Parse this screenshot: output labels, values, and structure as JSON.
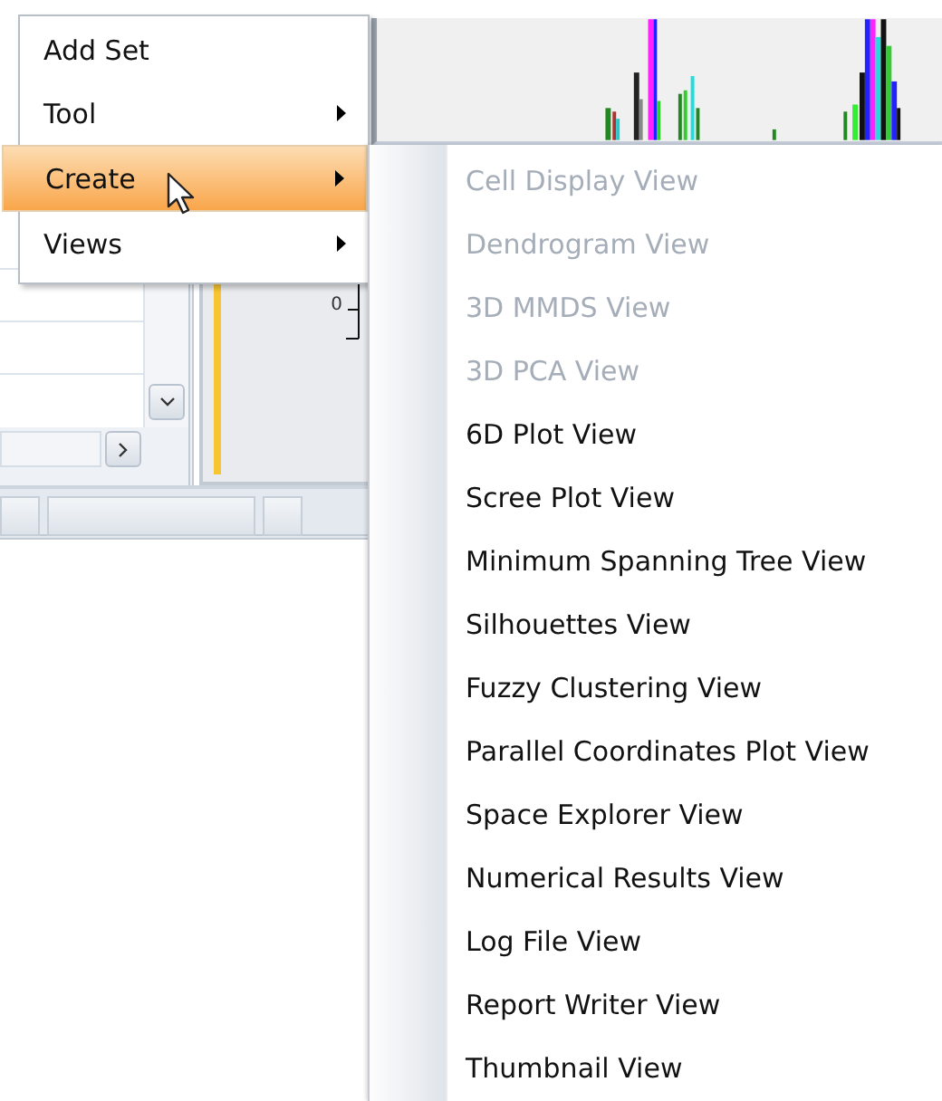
{
  "menu": {
    "items": [
      {
        "label": "Add Set",
        "has_submenu": false,
        "selected": false
      },
      {
        "label": "Tool",
        "has_submenu": true,
        "selected": false
      },
      {
        "label": "Create",
        "has_submenu": true,
        "selected": true
      },
      {
        "label": "Views",
        "has_submenu": true,
        "selected": false
      }
    ]
  },
  "submenu": {
    "items": [
      {
        "label": "Cell Display View",
        "disabled": true
      },
      {
        "label": "Dendrogram View",
        "disabled": true
      },
      {
        "label": "3D MMDS View",
        "disabled": true
      },
      {
        "label": "3D PCA View",
        "disabled": true
      },
      {
        "label": "6D Plot View",
        "disabled": false
      },
      {
        "label": "Scree Plot View",
        "disabled": false
      },
      {
        "label": "Minimum Spanning Tree View",
        "disabled": false
      },
      {
        "label": "Silhouettes View",
        "disabled": false
      },
      {
        "label": "Fuzzy Clustering View",
        "disabled": false
      },
      {
        "label": "Parallel Coordinates Plot View",
        "disabled": false
      },
      {
        "label": "Space Explorer View",
        "disabled": false
      },
      {
        "label": "Numerical Results View",
        "disabled": false
      },
      {
        "label": "Log File View",
        "disabled": false
      },
      {
        "label": "Report Writer View",
        "disabled": false
      },
      {
        "label": "Thumbnail View",
        "disabled": false
      }
    ]
  },
  "axis": {
    "tick_label": "0"
  }
}
